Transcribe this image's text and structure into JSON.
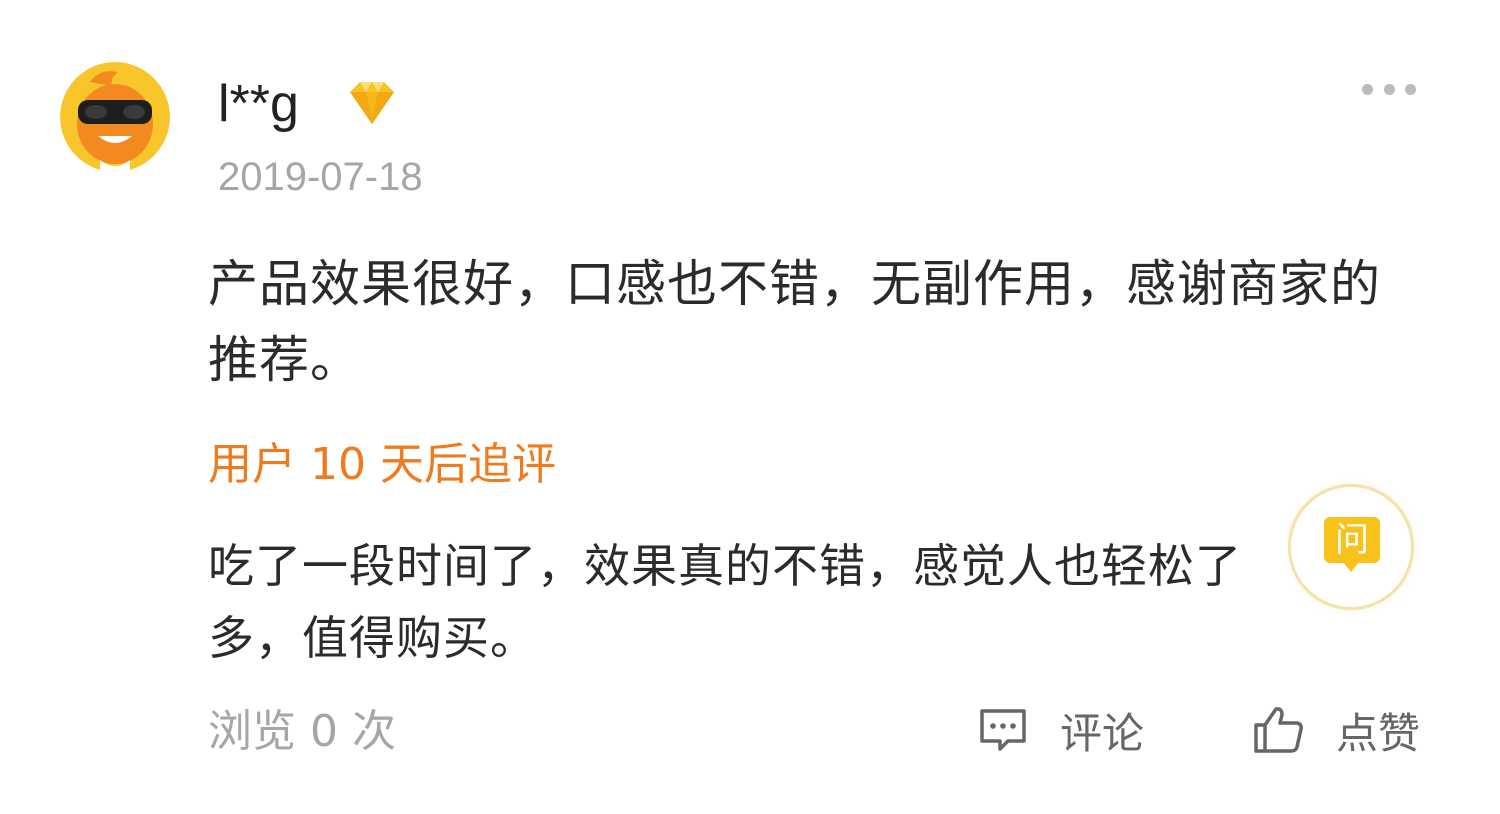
{
  "review": {
    "username": "l**g",
    "date": "2019-07-18",
    "content": "产品效果很好，口感也不错，无副作用，感谢商家的推荐。",
    "followup_title": "用户 10 天后追评",
    "followup_content": "吃了一段时间了，效果真的不错，感觉人也轻松了多，值得购买。",
    "ask_label": "问",
    "views": "浏览 0 次",
    "comment_label": "评论",
    "like_label": "点赞"
  },
  "icons": {
    "avatar": "cartoon-avatar-with-sunglasses",
    "badge": "diamond-vip-icon",
    "more": "more-dots-icon",
    "ask": "ask-question-icon",
    "comment": "comment-icon",
    "like": "thumbs-up-icon"
  },
  "colors": {
    "accent": "#f07b1e",
    "ask_yellow": "#f9c21a",
    "muted_text": "#a6a6a6",
    "body_text": "#2b2b2b"
  }
}
